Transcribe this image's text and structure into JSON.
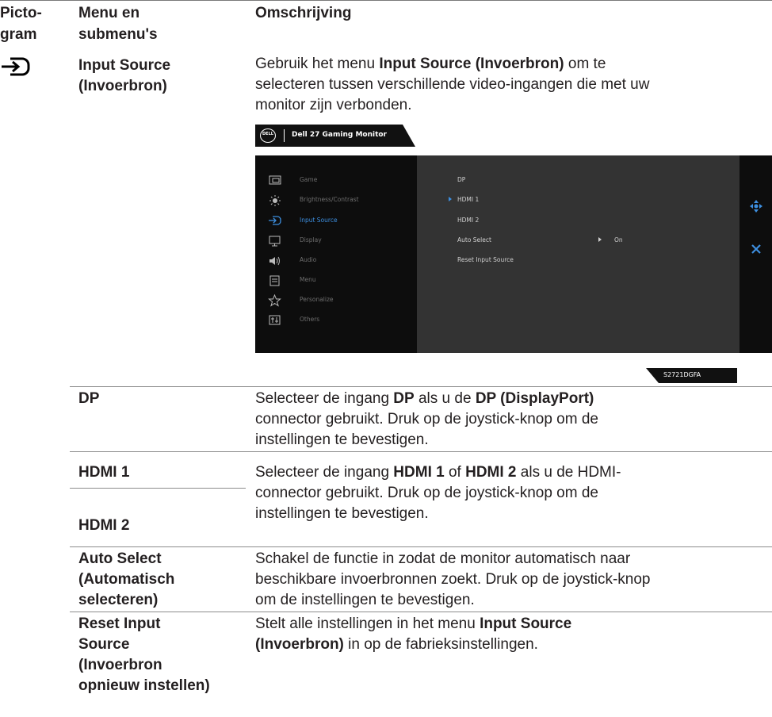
{
  "table": {
    "headers": {
      "icon_col_line1": "Picto-",
      "icon_col_line2": "gram",
      "menu_col_line1": "Menu en",
      "menu_col_line2": "submenu's",
      "desc_col": "Omschrijving"
    },
    "input_source": {
      "name_line1": "Input Source",
      "name_line2": "(Invoerbron)",
      "desc_l1_a": "Gebruik het menu ",
      "desc_l1_b": "Input Source (Invoerbron)",
      "desc_l1_c": " om te",
      "desc_l2": "selecteren tussen verschillende video-ingangen die met uw",
      "desc_l3": "monitor zijn verbonden."
    },
    "rows": {
      "dp": {
        "name": "DP",
        "l1_a": "Selecteer de ingang ",
        "l1_b": "DP",
        "l1_c": " als u de ",
        "l1_d": "DP (DisplayPort)",
        "l2": "connector gebruikt. Druk op de joystick-knop om de",
        "l3": "instellingen te bevestigen."
      },
      "hdmi": {
        "name1": "HDMI 1",
        "name2": "HDMI 2",
        "l1_a": "Selecteer de ingang ",
        "l1_b": "HDMI 1",
        "l1_c": " of ",
        "l1_d": "HDMI 2",
        "l1_e": " als u de HDMI-",
        "l2": "connector gebruikt. Druk op de joystick-knop om de",
        "l3": "instellingen te bevestigen."
      },
      "auto": {
        "name_l1": "Auto Select",
        "name_l2": "(Automatisch",
        "name_l3": "selecteren)",
        "l1": "Schakel de functie in zodat de monitor automatisch naar",
        "l2": "beschikbare invoerbronnen zoekt. Druk op de joystick-knop",
        "l3": "om de instellingen te bevestigen."
      },
      "reset": {
        "name_l1": "Reset Input",
        "name_l2": "Source",
        "name_l3": "(Invoerbron",
        "name_l4": "opnieuw instellen)",
        "l1_a": "Stelt alle instellingen in het menu ",
        "l1_b": "Input Source",
        "l2_a": "(Invoerbron)",
        "l2_b": " in op de fabrieksinstellingen."
      }
    }
  },
  "osd": {
    "logo": "DELL",
    "title": "Dell 27 Gaming Monitor",
    "model": "S2721DGFA",
    "menu_items": [
      {
        "label": "Game",
        "icon": "game-icon"
      },
      {
        "label": "Brightness/Contrast",
        "icon": "brightness-icon"
      },
      {
        "label": "Input Source",
        "icon": "input-source-icon"
      },
      {
        "label": "Display",
        "icon": "display-icon"
      },
      {
        "label": "Audio",
        "icon": "audio-icon"
      },
      {
        "label": "Menu",
        "icon": "menu-icon"
      },
      {
        "label": "Personalize",
        "icon": "star-icon"
      },
      {
        "label": "Others",
        "icon": "others-icon"
      }
    ],
    "submenu_items": [
      {
        "label": "DP"
      },
      {
        "label": "HDMI 1"
      },
      {
        "label": "HDMI 2"
      },
      {
        "label": "Auto Select",
        "value": "On"
      },
      {
        "label": "Reset Input Source"
      }
    ],
    "colors": {
      "panel_left": "#0d0d0d",
      "panel_right": "#333333",
      "accent": "#3d8fe0",
      "text": "#6e6e6e",
      "text_bright": "#d0d0d0"
    }
  }
}
